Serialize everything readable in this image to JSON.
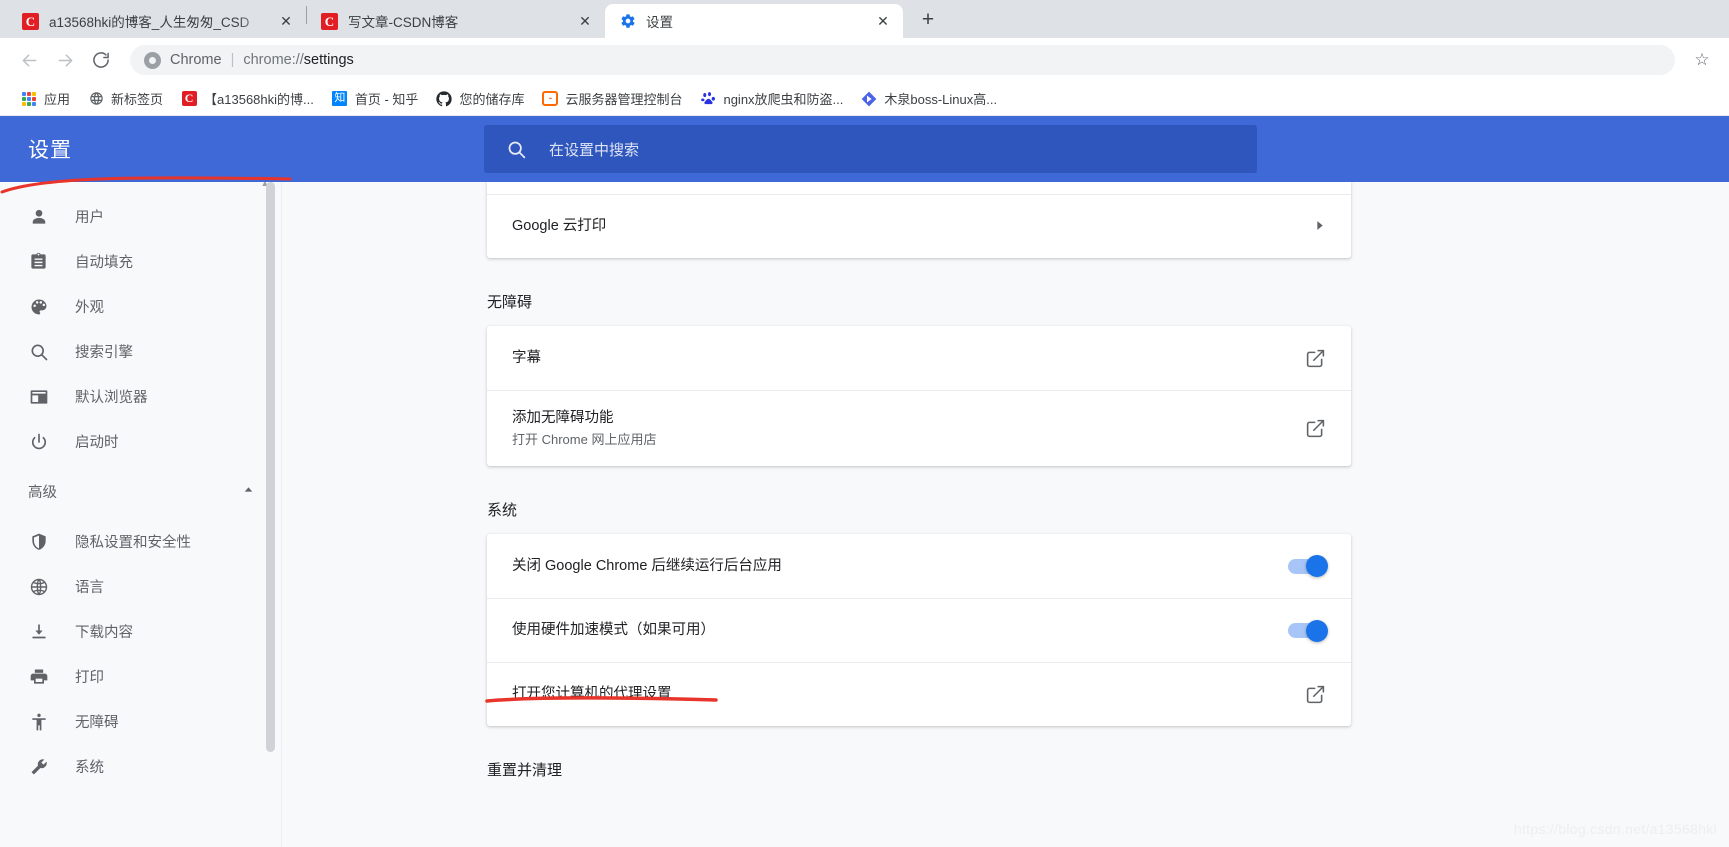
{
  "window": {
    "tabs": [
      {
        "title": "a13568hki的博客_人生匆匆_CSD",
        "favicon": "csdn-icon",
        "active": false,
        "close_label": "✕"
      },
      {
        "title": "写文章-CSDN博客",
        "favicon": "csdn-icon",
        "active": false,
        "close_label": "✕"
      },
      {
        "title": "设置",
        "favicon": "gear-icon",
        "active": true,
        "close_label": "✕"
      }
    ],
    "new_tab_label": "+"
  },
  "toolbar": {
    "back_label": "←",
    "forward_label": "→",
    "reload_label": "⟳",
    "omnibox": {
      "scheme_label": "Chrome",
      "divider": "|",
      "url_dim": "chrome://",
      "url_strong": "settings"
    },
    "bookmark_star_label": "☆"
  },
  "bookmarks_bar": {
    "items": [
      {
        "label": "应用",
        "icon": "apps-grid-icon"
      },
      {
        "label": "新标签页",
        "icon": "globe-icon"
      },
      {
        "label": "【a13568hki的博...",
        "icon": "csdn-icon"
      },
      {
        "label": "首页 - 知乎",
        "icon": "zhihu-icon"
      },
      {
        "label": "您的储存库",
        "icon": "github-icon"
      },
      {
        "label": "云服务器管理控制台",
        "icon": "console-icon"
      },
      {
        "label": "nginx放爬虫和防盗...",
        "icon": "baidu-icon"
      },
      {
        "label": "木泉boss-Linux高...",
        "icon": "blue-diamond-icon"
      }
    ]
  },
  "settings": {
    "title": "设置",
    "search": {
      "placeholder": "在设置中搜索",
      "icon": "search-icon"
    },
    "sidebar": {
      "items": [
        {
          "label": "用户",
          "icon": "person-icon"
        },
        {
          "label": "自动填充",
          "icon": "clipboard-icon"
        },
        {
          "label": "外观",
          "icon": "palette-icon"
        },
        {
          "label": "搜索引擎",
          "icon": "search-icon"
        },
        {
          "label": "默认浏览器",
          "icon": "browser-window-icon"
        },
        {
          "label": "启动时",
          "icon": "power-icon"
        }
      ],
      "advanced": {
        "label": "高级",
        "expand_icon": "chevron-up-icon"
      },
      "advanced_items": [
        {
          "label": "隐私设置和安全性",
          "icon": "shield-icon"
        },
        {
          "label": "语言",
          "icon": "globe-icon"
        },
        {
          "label": "下载内容",
          "icon": "download-icon"
        },
        {
          "label": "打印",
          "icon": "printer-icon"
        },
        {
          "label": "无障碍",
          "icon": "accessibility-icon"
        },
        {
          "label": "系统",
          "icon": "wrench-icon"
        }
      ]
    },
    "content": {
      "printing_card": {
        "rows": [
          {
            "title": "Google 云打印",
            "end": "chevron-right-icon"
          }
        ]
      },
      "accessibility": {
        "section_title": "无障碍",
        "rows": [
          {
            "title": "字幕",
            "sub": "",
            "end": "external-link-icon"
          },
          {
            "title": "添加无障碍功能",
            "sub": "打开 Chrome 网上应用店",
            "end": "external-link-icon"
          }
        ]
      },
      "system": {
        "section_title": "系统",
        "rows": [
          {
            "title": "关闭 Google Chrome 后继续运行后台应用",
            "sub": "",
            "end": "toggle-on"
          },
          {
            "title": "使用硬件加速模式（如果可用）",
            "sub": "",
            "end": "toggle-on"
          },
          {
            "title": "打开您计算机的代理设置",
            "sub": "",
            "end": "external-link-icon"
          }
        ]
      },
      "reset": {
        "section_title": "重置并清理"
      }
    }
  },
  "watermark": "https://blog.csdn.net/a13568hki",
  "colors": {
    "header_blue": "#3f69d6",
    "search_blue": "#2f56bd",
    "toggle_on": "#1a73e8",
    "annotation_red": "#e8342a",
    "page_bg": "#f8f9fa"
  }
}
